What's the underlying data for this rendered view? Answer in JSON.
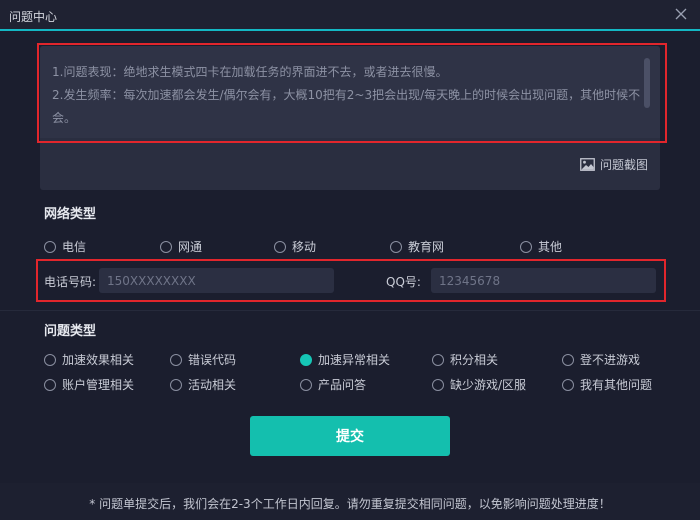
{
  "window": {
    "title": "问题中心"
  },
  "description": {
    "lines": [
      "1.问题表现：绝地求生模式四卡在加载任务的界面进不去，或者进去很慢。",
      "2.发生频率：每次加速都会发生/偶尔会有，大概10把有2~3把会出现/每天晚上的时候会出现问题，其他时候不会。"
    ],
    "screenshot_label": "问题截图"
  },
  "network": {
    "title": "网络类型",
    "options": [
      "电信",
      "网通",
      "移动",
      "教育网",
      "其他"
    ],
    "selected": "电信"
  },
  "contact": {
    "phone_label": "电话号码:",
    "phone_placeholder": "150XXXXXXXX",
    "qq_label": "QQ号:",
    "qq_placeholder": "12345678"
  },
  "problem": {
    "title": "问题类型",
    "options": [
      "加速效果相关",
      "错误代码",
      "加速异常相关",
      "积分相关",
      "登不进游戏",
      "账户管理相关",
      "活动相关",
      "产品问答",
      "缺少游戏/区服",
      "我有其他问题"
    ],
    "selected": "加速异常相关"
  },
  "submit_label": "提交",
  "footer_note": "* 问题单提交后，我们会在2-3个工作日内回复。请勿重复提交相同问题，以免影响问题处理进度！",
  "colors": {
    "accent": "#14bfae",
    "highlight": "#e2262c",
    "background": "#1b1e2e"
  }
}
